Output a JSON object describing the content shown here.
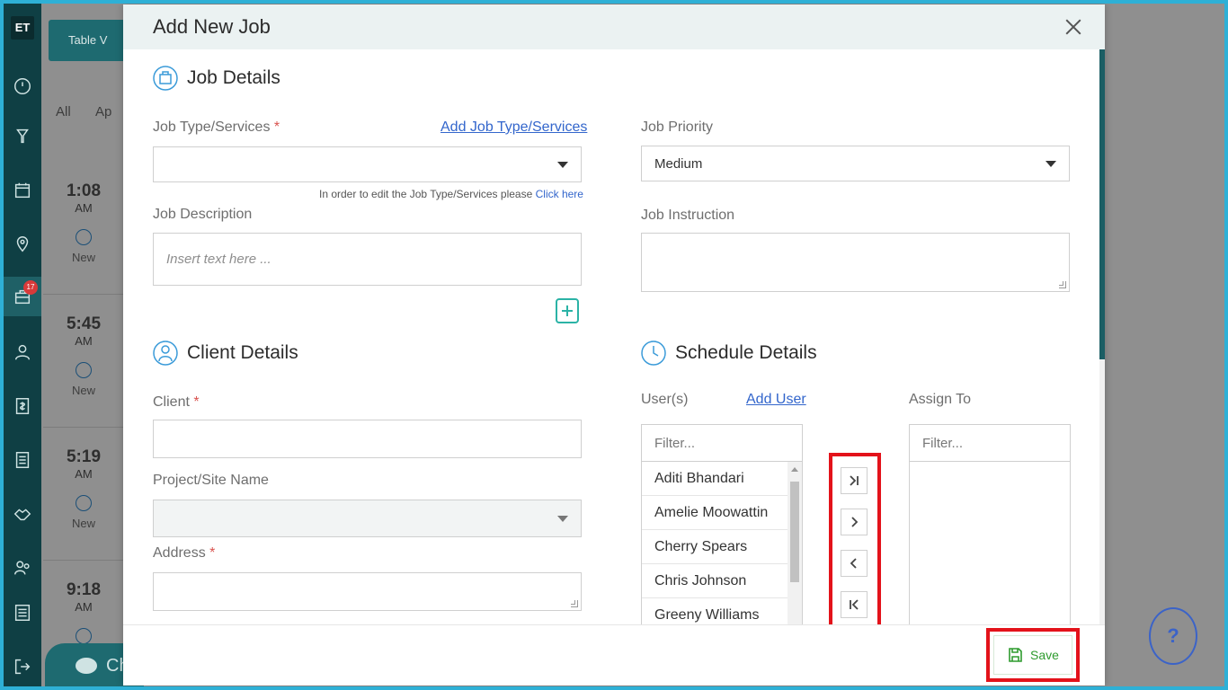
{
  "sidebar": {
    "logo": "ET",
    "badge_count": "17"
  },
  "background": {
    "table_view_label": "Table V",
    "tabs": [
      "All",
      "Ap"
    ],
    "jobs": [
      {
        "time": "1:08",
        "ampm": "AM",
        "status": "New"
      },
      {
        "time": "5:45",
        "ampm": "AM",
        "status": "New"
      },
      {
        "time": "5:19",
        "ampm": "AM",
        "status": "New"
      },
      {
        "time": "9:18",
        "ampm": "AM",
        "status": ""
      }
    ],
    "chat_label": "Ch"
  },
  "help_label": "?",
  "modal": {
    "title": "Add New Job",
    "job_details": {
      "title": "Job Details",
      "job_type_label": "Job Type/Services",
      "required_mark": "*",
      "add_job_type_link": "Add Job Type/Services",
      "job_type_value": "",
      "edit_hint": "In order to edit the Job Type/Services please",
      "edit_hint_link": "Click here",
      "job_description_label": "Job Description",
      "job_description_placeholder": "Insert text here ...",
      "job_priority_label": "Job Priority",
      "job_priority_value": "Medium",
      "job_instruction_label": "Job Instruction"
    },
    "client_details": {
      "title": "Client Details",
      "client_label": "Client",
      "project_label": "Project/Site Name",
      "address_label": "Address"
    },
    "schedule_details": {
      "title": "Schedule Details",
      "users_label": "User(s)",
      "add_user_link": "Add User",
      "assign_to_label": "Assign To",
      "filter_placeholder": "Filter...",
      "users": [
        "Aditi Bhandari",
        "Amelie Moowattin",
        "Cherry Spears",
        "Chris Johnson",
        "Greeny Williams"
      ]
    },
    "footer": {
      "save_label": "Save"
    }
  }
}
